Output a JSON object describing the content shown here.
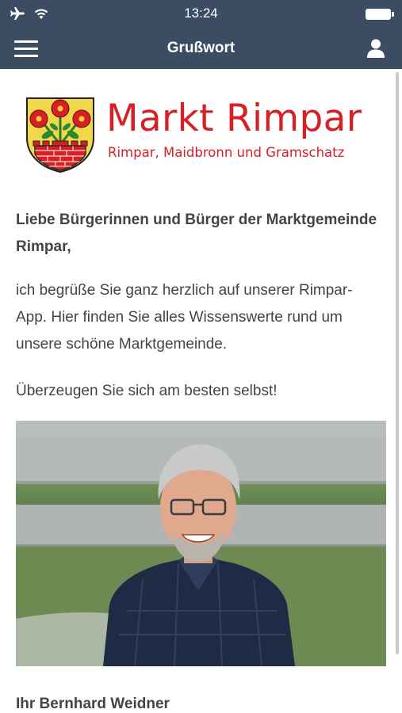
{
  "status_bar": {
    "time": "13:24",
    "icons": [
      "airplane-icon",
      "wifi-icon",
      "battery-icon"
    ]
  },
  "nav": {
    "title": "Grußwort",
    "menu_icon": "hamburger-menu-icon",
    "user_icon": "user-icon"
  },
  "colors": {
    "nav_background": "#3c4d63",
    "brand_red": "#d71f26",
    "body_text": "#444444"
  },
  "logo": {
    "title": "Markt Rimpar",
    "subtitle": "Rimpar, Maidbronn und Gramschatz"
  },
  "content": {
    "greeting": "Liebe Bürgerinnen und Bürger der Marktgemeinde Rimpar,",
    "body": "ich begrüße Sie ganz herzlich auf unserer Rimpar-App. Hier finden Sie alles Wissenswerte rund um unsere schöne Marktgemeinde.",
    "closing": "Überzeugen Sie sich am besten selbst!",
    "signature": "Ihr Bernhard Weidner"
  }
}
